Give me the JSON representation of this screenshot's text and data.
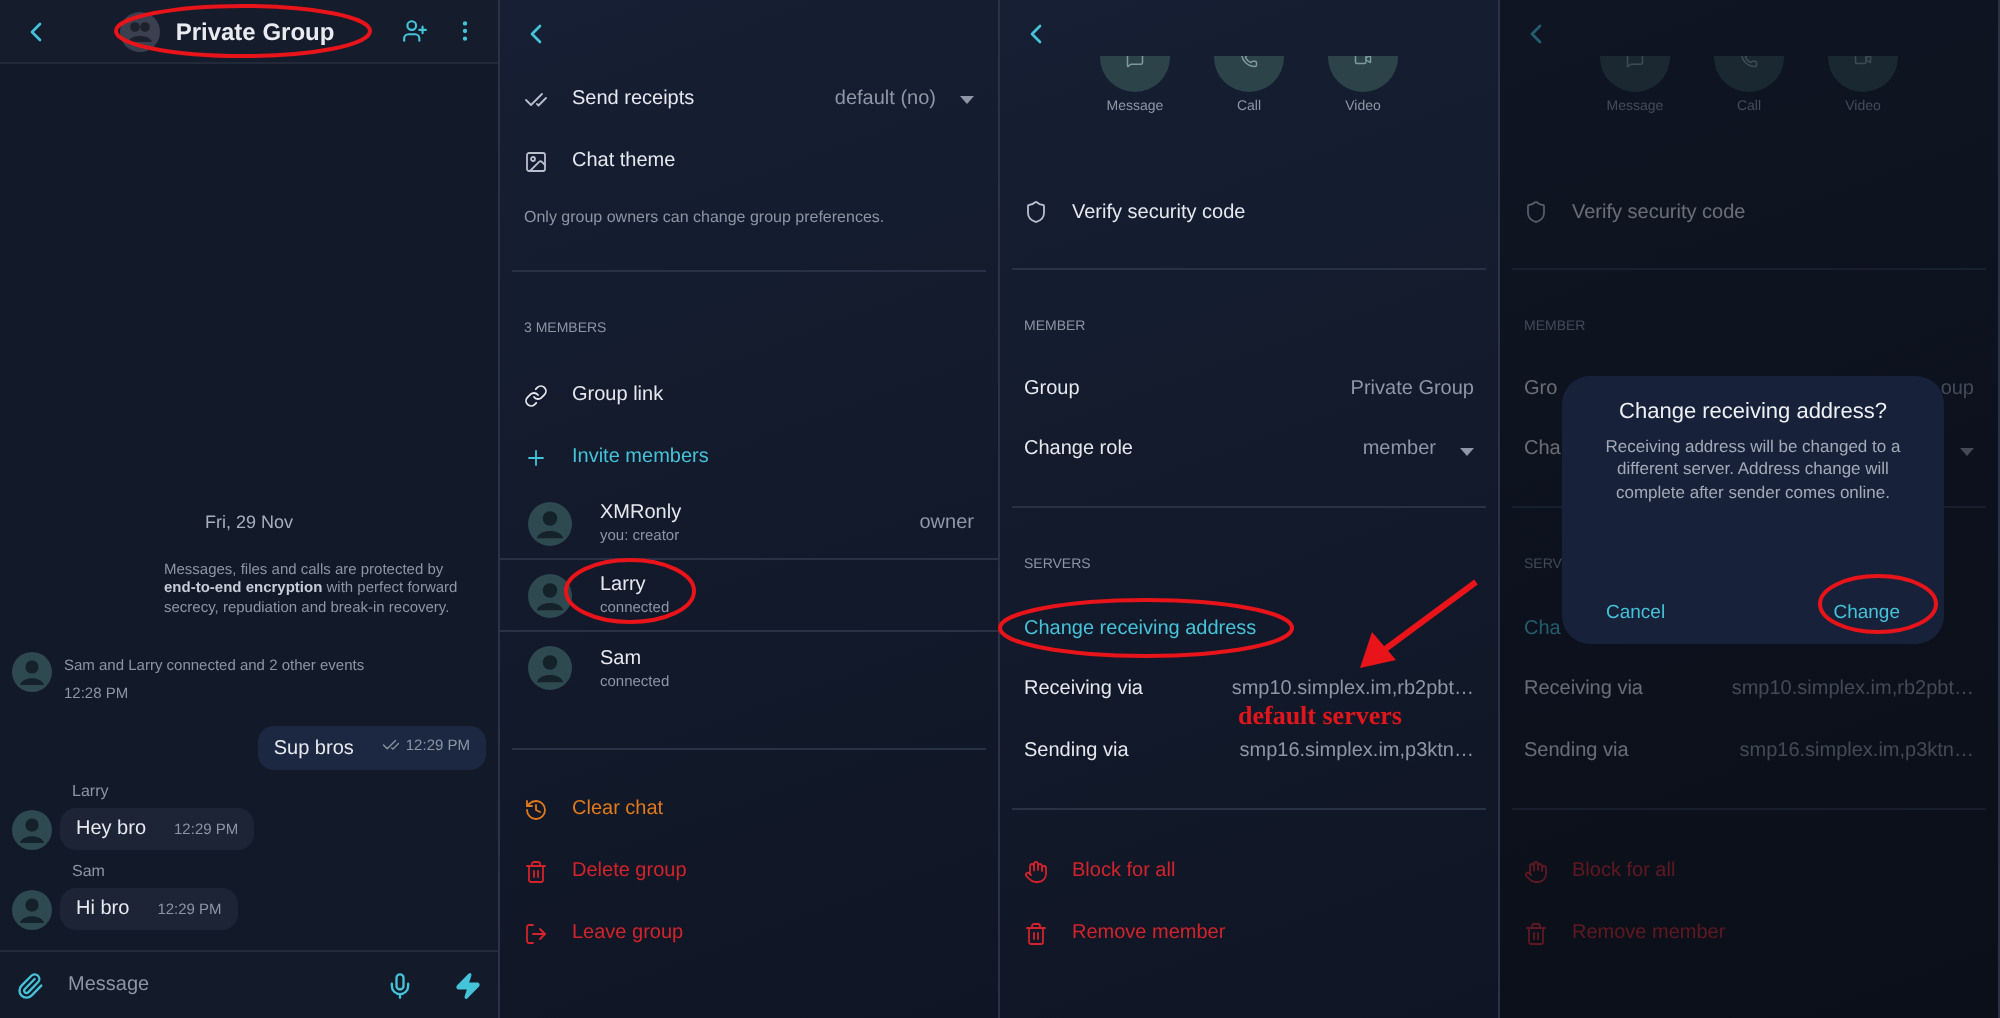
{
  "chat": {
    "title": "Private Group",
    "date": "Fri, 29 Nov",
    "notice": "Messages, files and calls are protected by **end-to-end encryption** with perfect forward secrecy, repudiation and break-in recovery.",
    "event": {
      "text": "Sam and Larry connected and 2 other events",
      "time": "12:28 PM"
    },
    "messages": [
      {
        "kind": "sent",
        "text": "Sup bros",
        "time": "12:29 PM"
      },
      {
        "kind": "received",
        "sender": "Larry",
        "text": "Hey bro",
        "time": "12:29 PM"
      },
      {
        "kind": "received",
        "sender": "Sam",
        "text": "Hi bro",
        "time": "12:29 PM"
      }
    ],
    "composer": {
      "placeholder": "Message"
    }
  },
  "group_info": {
    "preferences": [
      {
        "label": "Send receipts",
        "value": "default (no)"
      },
      {
        "label": "Chat theme"
      }
    ],
    "note": "Only group owners can change group preferences.",
    "members_heading": "3 MEMBERS",
    "actions": [
      {
        "label": "Group link",
        "kind": "plain"
      },
      {
        "label": "Invite members",
        "kind": "accent"
      }
    ],
    "members": [
      {
        "name": "XMRonly",
        "status": "you: creator",
        "role": "owner"
      },
      {
        "name": "Larry",
        "status": "connected"
      },
      {
        "name": "Sam",
        "status": "connected"
      }
    ],
    "danger_actions": [
      {
        "label": "Clear chat",
        "kind": "warning"
      },
      {
        "label": "Delete group",
        "kind": "danger"
      },
      {
        "label": "Leave group",
        "kind": "danger"
      }
    ]
  },
  "member_info": {
    "dimmed": false,
    "quick_actions": [
      "Message",
      "Call",
      "Video"
    ],
    "verify": "Verify security code",
    "member_heading": "MEMBER",
    "fields": [
      {
        "label": "Group",
        "value": "Private Group",
        "kind": "text"
      },
      {
        "label": "Change role",
        "value": "member",
        "kind": "dropdown"
      }
    ],
    "servers_heading": "SERVERS",
    "change_address": "Change receiving address",
    "servers": [
      {
        "label": "Receiving via",
        "value": "smp10.simplex.im,rb2pbt…"
      },
      {
        "label": "Sending via",
        "value": "smp16.simplex.im,p3ktn…"
      }
    ],
    "actions": [
      {
        "label": "Block for all",
        "kind": "danger"
      },
      {
        "label": "Remove member",
        "kind": "danger"
      }
    ]
  },
  "member_info_dialog": {
    "dimmed": true,
    "quick_actions": [
      "Message",
      "Call",
      "Video"
    ],
    "verify": "Verify security code",
    "member_heading": "MEMBER",
    "fields": [
      {
        "label": "Gro",
        "value": "oup",
        "kind": "text"
      },
      {
        "label": "Cha",
        "kind": "dropdown"
      }
    ],
    "servers_heading": "SERV",
    "change_address": "Cha",
    "servers": [
      {
        "label": "Receiving via",
        "value": "smp10.simplex.im,rb2pbt…"
      },
      {
        "label": "Sending via",
        "value": "smp16.simplex.im,p3ktn…"
      }
    ],
    "actions": [
      {
        "label": "Block for all",
        "kind": "danger"
      },
      {
        "label": "Remove member",
        "kind": "danger"
      }
    ],
    "dialog": {
      "title": "Change receiving address?",
      "message": "Receiving address will be changed to a different server. Address change will complete after sender comes online.",
      "buttons": [
        {
          "label": "Cancel"
        },
        {
          "label": "Change"
        }
      ]
    }
  },
  "annotation": {
    "note": "default servers"
  }
}
